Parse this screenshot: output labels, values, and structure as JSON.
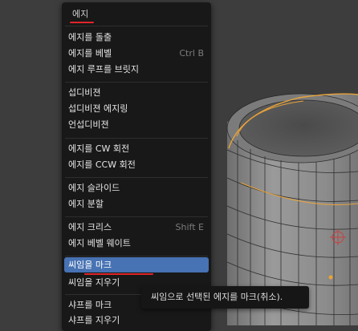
{
  "menu": {
    "title": "에지",
    "groups": [
      [
        {
          "label": "에지를 돌출",
          "shortcut": ""
        },
        {
          "label": "에지를 베벨",
          "shortcut": "Ctrl B"
        },
        {
          "label": "에지 루프를 브릿지",
          "shortcut": ""
        }
      ],
      [
        {
          "label": "섭디비젼",
          "shortcut": ""
        },
        {
          "label": "섭디비젼 에지링",
          "shortcut": ""
        },
        {
          "label": "언섭디비젼",
          "shortcut": ""
        }
      ],
      [
        {
          "label": "에지를 CW 회전",
          "shortcut": ""
        },
        {
          "label": "에지를 CCW 회전",
          "shortcut": ""
        }
      ],
      [
        {
          "label": "에지 슬라이드",
          "shortcut": ""
        },
        {
          "label": "에지 분할",
          "shortcut": ""
        }
      ],
      [
        {
          "label": "에지 크리스",
          "shortcut": "Shift E"
        },
        {
          "label": "에지 베벨 웨이트",
          "shortcut": ""
        }
      ],
      [
        {
          "label": "씨임을 마크",
          "shortcut": "",
          "active": true
        },
        {
          "label": "씨임을 지우기",
          "shortcut": ""
        }
      ],
      [
        {
          "label": "샤프를 마크",
          "shortcut": ""
        },
        {
          "label": "샤프를 지우기",
          "shortcut": ""
        }
      ]
    ]
  },
  "tooltip": {
    "text": "씨임으로 선택된 에지를 마크(취소)."
  },
  "colors": {
    "highlight": "#4772b3",
    "annotation_red": "#e0242a",
    "menu_bg": "#181818",
    "mesh_fill": "#8a8a8a",
    "selected_edge": "#e8a33a"
  }
}
